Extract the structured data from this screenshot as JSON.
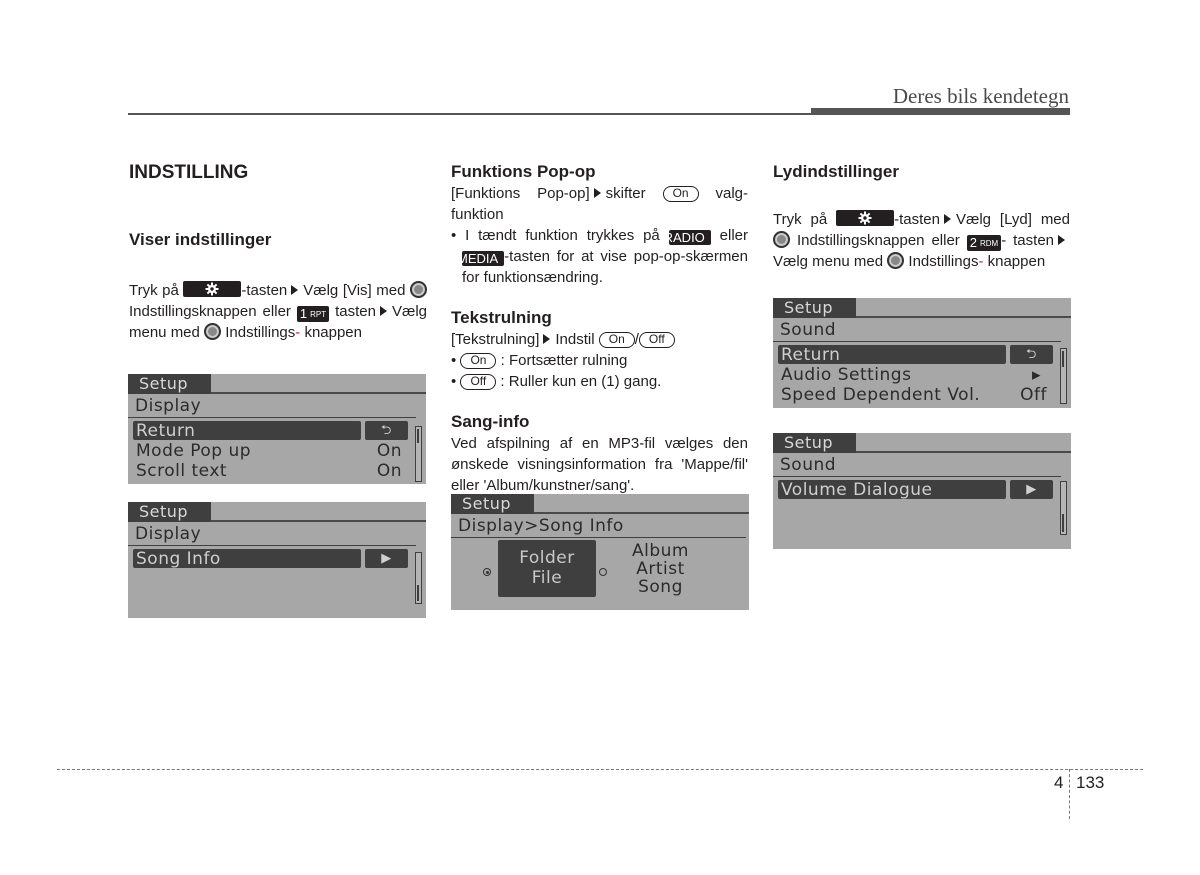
{
  "header": {
    "title": "Deres bils kendetegn"
  },
  "col1": {
    "section_title": "INDSTILLING",
    "subheading": "Viser indstillinger",
    "para": {
      "p1": "Tryk på",
      "p2": "-tasten",
      "p3": "Vælg [Vis]",
      "p4": "med",
      "p5": "Indstillingsknappen eller",
      "key_num": "1",
      "key_sub": "RPT",
      "p6": "tasten",
      "p7": "Vælg menu med",
      "p8": "Indstillings",
      "p8_hyphen": "-",
      "p9": "knappen"
    },
    "screen1": {
      "tab": "Setup",
      "breadcrumb": "Display",
      "rows": [
        {
          "label": "Return",
          "button": "return-icon"
        },
        {
          "label": "Mode Pop up",
          "value": "On"
        },
        {
          "label": "Scroll text",
          "value": "On"
        }
      ]
    },
    "screen2": {
      "tab": "Setup",
      "breadcrumb": "Display",
      "rows": [
        {
          "label": "Song Info",
          "button": "arrow-right-icon"
        }
      ]
    }
  },
  "col2": {
    "funktions": {
      "heading": "Funktions Pop-op",
      "l1a": "[Funktions Pop-op]",
      "l1b": "skifter",
      "pill_on": "On",
      "l1c": "valg-funktion",
      "b1a": "• I tændt funktion trykkes på",
      "key_radio": "RADIO",
      "b1b": "eller",
      "key_media": "MEDIA",
      "b1c": "-tasten for at vise pop-op-skærmen for funktionsændring."
    },
    "tekst": {
      "heading": "Tekstrulning",
      "l1a": "[Tekstrulning]",
      "l1b": "Indstil",
      "pill_on": "On",
      "slash": "/",
      "pill_off": "Off",
      "b1": ": Fortsætter rulning",
      "b2": ": Ruller kun en (1) gang.",
      "bullet": "•"
    },
    "sang": {
      "heading": "Sang-info",
      "text": "Ved afspilning af en MP3-fil vælges den ønskede visningsinformation fra 'Mappe/fil' eller 'Album/kunstner/sang'."
    },
    "screen": {
      "tab": "Setup",
      "breadcrumb": "Display>Song Info",
      "option1_line1": "Folder",
      "option1_line2": "File",
      "option2_line1": "Album",
      "option2_line2": "Artist",
      "option2_line3": "Song",
      "selected": "Folder/File"
    }
  },
  "col3": {
    "heading": "Lydindstillinger",
    "para": {
      "p1": "Tryk på",
      "p2": "-tasten",
      "p3": "Vælg [Lyd]",
      "p4": "med",
      "p5": "Indstillingsknappen eller",
      "key_num": "2",
      "key_sub": "RDM",
      "p5b": "-",
      "p6": "tasten",
      "p7": "Vælg menu med",
      "p8": "Indstillings",
      "p8_hyphen": "-",
      "p9": "knappen"
    },
    "screen1": {
      "tab": "Setup",
      "breadcrumb": "Sound",
      "rows": [
        {
          "label": "Return",
          "button": "return-icon"
        },
        {
          "label": "Audio Settings",
          "value": "▸"
        },
        {
          "label": "Speed Dependent Vol.",
          "value": "Off"
        }
      ]
    },
    "screen2": {
      "tab": "Setup",
      "breadcrumb": "Sound",
      "rows": [
        {
          "label": "Volume Dialogue",
          "button": "arrow-right-icon"
        }
      ]
    }
  },
  "footer": {
    "chapter": "4",
    "page": "133"
  }
}
